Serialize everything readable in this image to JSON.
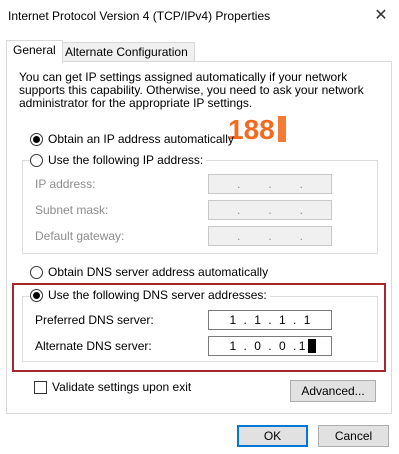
{
  "window": {
    "title": "Internet Protocol Version 4 (TCP/IPv4) Properties",
    "close_glyph": "✕"
  },
  "tabs": [
    {
      "label": "General",
      "active": true
    },
    {
      "label": "Alternate Configuration",
      "active": false
    }
  ],
  "description": "You can get IP settings assigned automatically if your network supports this capability. Otherwise, you need to ask your network administrator for the appropriate IP settings.",
  "ip_section": {
    "auto_label": "Obtain an IP address automatically",
    "auto_checked": true,
    "manual_label": "Use the following IP address:",
    "manual_checked": false,
    "fields": [
      {
        "label": "IP address:",
        "value": ". . ."
      },
      {
        "label": "Subnet mask:",
        "value": ". . ."
      },
      {
        "label": "Default gateway:",
        "value": ". . ."
      }
    ]
  },
  "dns_section": {
    "auto_label": "Obtain DNS server address automatically",
    "auto_checked": false,
    "manual_label": "Use the following DNS server addresses:",
    "manual_checked": true,
    "preferred": {
      "label": "Preferred DNS server:",
      "octets": [
        "1",
        "1",
        "1",
        "1"
      ]
    },
    "alternate": {
      "label": "Alternate DNS server:",
      "octets": [
        "1",
        "0",
        "0",
        "1"
      ]
    }
  },
  "validate": {
    "label": "Validate settings upon exit",
    "checked": false
  },
  "buttons": {
    "advanced": "Advanced...",
    "ok": "OK",
    "cancel": "Cancel"
  },
  "watermark": {
    "text": "188"
  },
  "colors": {
    "highlight": "#a8262e",
    "accent": "#0078d7",
    "logo": "#f26b21"
  }
}
